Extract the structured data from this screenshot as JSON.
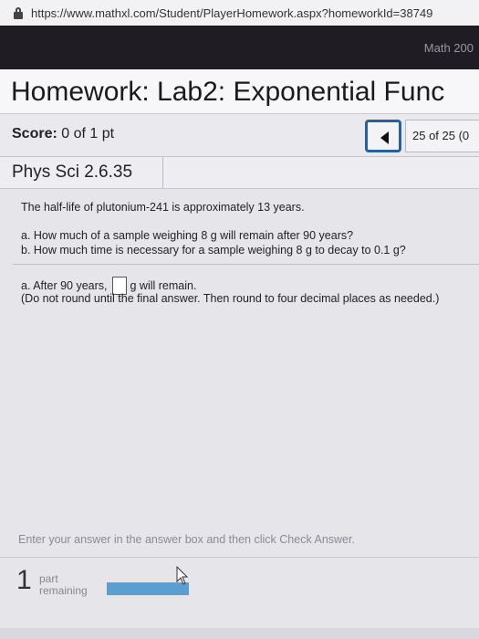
{
  "browser": {
    "url": "https://www.mathxl.com/Student/PlayerHomework.aspx?homeworkId=38749"
  },
  "header": {
    "course": "Math 200"
  },
  "homework": {
    "title": "Homework: Lab2: Exponential Func",
    "score_label": "Score:",
    "score_value": "0 of 1 pt",
    "question_counter": "25 of 25 (0",
    "question_id": "Phys Sci 2.6.35"
  },
  "question": {
    "intro": "The half-life of plutonium-241 is approximately 13 years.",
    "part_a": "a. How much of a sample weighing 8 g will remain after 90 years?",
    "part_b": "b. How much time is necessary for a sample weighing 8 g to decay to 0.1 g?"
  },
  "answer": {
    "prefix": "a. After 90 years,",
    "value": "",
    "suffix": "g will remain.",
    "note": "(Do not round until the final answer. Then round to four decimal places as needed.)"
  },
  "footer": {
    "instruction": "Enter your answer in the answer box and then click Check Answer.",
    "parts_count": "1",
    "parts_label_1": "part",
    "parts_label_2": "remaining"
  }
}
